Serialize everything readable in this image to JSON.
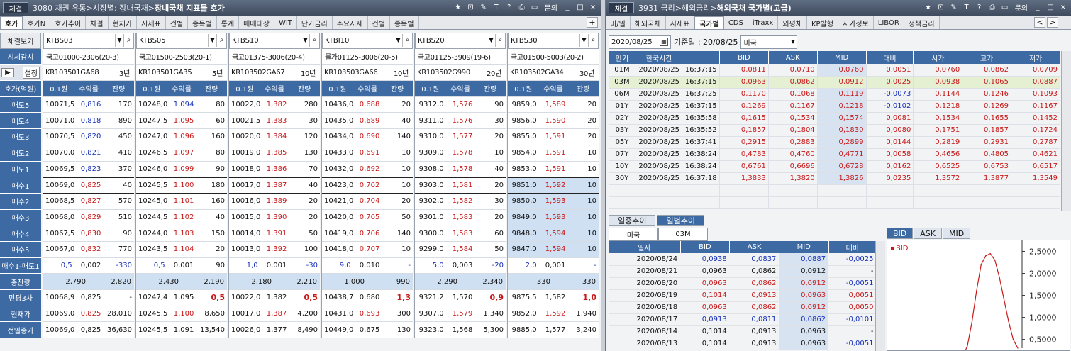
{
  "left": {
    "title_prefix": "3080 채권 유통>시장별: 장내국채>",
    "title_bold": "장내국채 지표물 호가",
    "logo": "체결",
    "tabs": [
      "호가",
      "호가N",
      "호가추이",
      "체결",
      "현재가",
      "시세표",
      "건별",
      "종목별",
      "통계",
      "매매대상",
      "WIT",
      "단기금리",
      "주요시세",
      "건별",
      "종목별"
    ],
    "window_buttons": [
      "★",
      "⊡",
      "✎",
      "T",
      "?",
      "⎙",
      "▭",
      "문의",
      "_",
      "□",
      "×"
    ],
    "add_tab": "+",
    "side_labels": [
      "체결보기",
      "시세감시",
      "설정",
      "호가(억원)",
      "매도5",
      "매도4",
      "매도3",
      "매도2",
      "매도1",
      "매수1",
      "매수2",
      "매수3",
      "매수4",
      "매수5",
      "매수1-매도1",
      "총잔량",
      "민평3사",
      "현재가",
      "전일종가"
    ],
    "side_play": "▶",
    "col_headers": [
      "0.1원",
      "수익률",
      "잔량"
    ],
    "panels": [
      {
        "code": "KTBS03",
        "name": "국고01000-2306(20-3)",
        "isin": "KR103501GA68",
        "term": "3년",
        "rows": [
          [
            "10071,5",
            "0,816",
            "170"
          ],
          [
            "10071,0",
            "0,818",
            "890"
          ],
          [
            "10070,5",
            "0,820",
            "450"
          ],
          [
            "10070,0",
            "0,821",
            "410"
          ],
          [
            "10069,5",
            "0,823",
            "370"
          ],
          [
            "10069,0",
            "0,825",
            "40"
          ],
          [
            "10068,5",
            "0,827",
            "570"
          ],
          [
            "10068,0",
            "0,829",
            "510"
          ],
          [
            "10067,5",
            "0,830",
            "90"
          ],
          [
            "10067,0",
            "0,832",
            "770"
          ]
        ],
        "diff": [
          "0,5",
          "0,002",
          "-330"
        ],
        "total": [
          "2,790",
          "2,820"
        ],
        "minpyeong": [
          "10068,9",
          "0,825",
          "-"
        ],
        "current": [
          "10069,0",
          "0,825",
          "28,010"
        ],
        "prev": [
          "10069,0",
          "0,825",
          "36,630"
        ]
      },
      {
        "code": "KTBS05",
        "name": "국고01500-2503(20-1)",
        "isin": "KR103501GA35",
        "term": "5년",
        "rows": [
          [
            "10248,0",
            "1,094",
            "80"
          ],
          [
            "10247,5",
            "1,095",
            "60"
          ],
          [
            "10247,0",
            "1,096",
            "160"
          ],
          [
            "10246,5",
            "1,097",
            "80"
          ],
          [
            "10246,0",
            "1,099",
            "90"
          ],
          [
            "10245,5",
            "1,100",
            "180"
          ],
          [
            "10245,0",
            "1,101",
            "160"
          ],
          [
            "10244,5",
            "1,102",
            "40"
          ],
          [
            "10244,0",
            "1,103",
            "150"
          ],
          [
            "10243,5",
            "1,104",
            "20"
          ]
        ],
        "diff": [
          "0,5",
          "0,001",
          "90"
        ],
        "total": [
          "2,430",
          "2,190"
        ],
        "minpyeong": [
          "10247,4",
          "1,095",
          "0,5"
        ],
        "current": [
          "10245,5",
          "1,100",
          "8,650"
        ],
        "prev": [
          "10245,5",
          "1,091",
          "13,540"
        ]
      },
      {
        "code": "KTBS10",
        "name": "국고01375-3006(20-4)",
        "isin": "KR103502GA67",
        "term": "10년",
        "rows": [
          [
            "10022,0",
            "1,382",
            "280"
          ],
          [
            "10021,5",
            "1,383",
            "30"
          ],
          [
            "10020,0",
            "1,384",
            "120"
          ],
          [
            "10019,0",
            "1,385",
            "130"
          ],
          [
            "10018,0",
            "1,386",
            "70"
          ],
          [
            "10017,0",
            "1,387",
            "40"
          ],
          [
            "10016,0",
            "1,389",
            "20"
          ],
          [
            "10015,0",
            "1,390",
            "20"
          ],
          [
            "10014,0",
            "1,391",
            "50"
          ],
          [
            "10013,0",
            "1,392",
            "100"
          ]
        ],
        "diff": [
          "1,0",
          "0,001",
          "-30"
        ],
        "total": [
          "2,180",
          "2,210"
        ],
        "minpyeong": [
          "10022,0",
          "1,382",
          "0,5"
        ],
        "current": [
          "10017,0",
          "1,387",
          "4,200"
        ],
        "prev": [
          "10026,0",
          "1,377",
          "8,490"
        ]
      },
      {
        "code": "KTBI10",
        "name": "물가01125-3006(20-5)",
        "isin": "KR103503GA66",
        "term": "10년",
        "rows": [
          [
            "10436,0",
            "0,688",
            "20"
          ],
          [
            "10435,0",
            "0,689",
            "40"
          ],
          [
            "10434,0",
            "0,690",
            "140"
          ],
          [
            "10433,0",
            "0,691",
            "10"
          ],
          [
            "10432,0",
            "0,692",
            "10"
          ],
          [
            "10423,0",
            "0,702",
            "10"
          ],
          [
            "10421,0",
            "0,704",
            "20"
          ],
          [
            "10420,0",
            "0,705",
            "50"
          ],
          [
            "10419,0",
            "0,706",
            "140"
          ],
          [
            "10418,0",
            "0,707",
            "10"
          ]
        ],
        "diff": [
          "9,0",
          "0,010",
          "-"
        ],
        "total": [
          "1,000",
          "990"
        ],
        "minpyeong": [
          "10438,7",
          "0,680",
          "1,3"
        ],
        "current": [
          "10431,0",
          "0,693",
          "300"
        ],
        "prev": [
          "10449,0",
          "0,675",
          "130"
        ]
      },
      {
        "code": "KTBS20",
        "name": "국고01125-3909(19-6)",
        "isin": "KR103502G990",
        "term": "20년",
        "rows": [
          [
            "9312,0",
            "1,576",
            "90"
          ],
          [
            "9311,0",
            "1,576",
            "30"
          ],
          [
            "9310,0",
            "1,577",
            "20"
          ],
          [
            "9309,0",
            "1,578",
            "10"
          ],
          [
            "9308,0",
            "1,578",
            "40"
          ],
          [
            "9303,0",
            "1,581",
            "20"
          ],
          [
            "9302,0",
            "1,582",
            "30"
          ],
          [
            "9301,0",
            "1,583",
            "20"
          ],
          [
            "9300,0",
            "1,583",
            "60"
          ],
          [
            "9299,0",
            "1,584",
            "50"
          ]
        ],
        "diff": [
          "5,0",
          "0,003",
          "-20"
        ],
        "total": [
          "2,290",
          "2,340"
        ],
        "minpyeong": [
          "9321,2",
          "1,570",
          "0,9"
        ],
        "current": [
          "9307,0",
          "1,579",
          "1,340"
        ],
        "prev": [
          "9323,0",
          "1,568",
          "5,300"
        ]
      },
      {
        "code": "KTBS30",
        "name": "국고01500-5003(20-2)",
        "isin": "KR103502GA34",
        "term": "30년",
        "rows": [
          [
            "9859,0",
            "1,589",
            "20"
          ],
          [
            "9856,0",
            "1,590",
            "20"
          ],
          [
            "9855,0",
            "1,591",
            "20"
          ],
          [
            "9854,0",
            "1,591",
            "10"
          ],
          [
            "9853,0",
            "1,591",
            "10"
          ],
          [
            "9851,0",
            "1,592",
            "10"
          ],
          [
            "9850,0",
            "1,593",
            "10"
          ],
          [
            "9849,0",
            "1,593",
            "10"
          ],
          [
            "9848,0",
            "1,594",
            "10"
          ],
          [
            "9847,0",
            "1,594",
            "10"
          ]
        ],
        "diff": [
          "2,0",
          "0,001",
          "-"
        ],
        "total": [
          "330",
          "330"
        ],
        "minpyeong": [
          "9875,5",
          "1,582",
          "1,0"
        ],
        "current": [
          "9852,0",
          "1,592",
          "1,940"
        ],
        "prev": [
          "9885,0",
          "1,577",
          "3,240"
        ]
      }
    ]
  },
  "right": {
    "title_prefix": "3931 금리>해외금리>",
    "title_bold": "해외국채 국가별(고급)",
    "logo": "체결",
    "tabs": [
      "미/일",
      "해외국채",
      "시세표",
      "국가별",
      "CDS",
      "iTraxx",
      "외평채",
      "KP발행",
      "시가정보",
      "LIBOR",
      "정책금리"
    ],
    "window_buttons": [
      "★",
      "⊡",
      "✎",
      "T",
      "?",
      "⎙",
      "▭",
      "문의",
      "_",
      "□",
      "×"
    ],
    "nav": [
      "<",
      ">"
    ],
    "date": "2020/08/25",
    "base_date_label": "기준일 : 20/08/25",
    "country": "미국",
    "headers": [
      "만기",
      "한국시간",
      "",
      "BID",
      "ASK",
      "MID",
      "대비",
      "시가",
      "고가",
      "저가"
    ],
    "rows": [
      [
        "01M",
        "2020/08/25",
        "16:37:15",
        "0,0811",
        "0,0710",
        "0,0760",
        "0,0051",
        "0,0760",
        "0,0862",
        "0,0709"
      ],
      [
        "03M",
        "2020/08/25",
        "16:37:15",
        "0,0963",
        "0,0862",
        "0,0912",
        "0,0025",
        "0,0938",
        "0,1065",
        "0,0887"
      ],
      [
        "06M",
        "2020/08/25",
        "16:37:25",
        "0,1170",
        "0,1068",
        "0,1119",
        "-0,0073",
        "0,1144",
        "0,1246",
        "0,1093"
      ],
      [
        "01Y",
        "2020/08/25",
        "16:37:15",
        "0,1269",
        "0,1167",
        "0,1218",
        "-0,0102",
        "0,1218",
        "0,1269",
        "0,1167"
      ],
      [
        "02Y",
        "2020/08/25",
        "16:35:58",
        "0,1615",
        "0,1534",
        "0,1574",
        "0,0081",
        "0,1534",
        "0,1655",
        "0,1452"
      ],
      [
        "03Y",
        "2020/08/25",
        "16:35:52",
        "0,1857",
        "0,1804",
        "0,1830",
        "0,0080",
        "0,1751",
        "0,1857",
        "0,1724"
      ],
      [
        "05Y",
        "2020/08/25",
        "16:37:41",
        "0,2915",
        "0,2883",
        "0,2899",
        "0,0144",
        "0,2819",
        "0,2931",
        "0,2787"
      ],
      [
        "07Y",
        "2020/08/25",
        "16:38:24",
        "0,4783",
        "0,4760",
        "0,4771",
        "0,0058",
        "0,4656",
        "0,4805",
        "0,4621"
      ],
      [
        "10Y",
        "2020/08/25",
        "16:38:24",
        "0,6761",
        "0,6696",
        "0,6728",
        "0,0162",
        "0,6525",
        "0,6753",
        "0,6517"
      ],
      [
        "30Y",
        "2020/08/25",
        "16:37:18",
        "1,3833",
        "1,3820",
        "1,3826",
        "0,0235",
        "1,3572",
        "1,3877",
        "1,3549"
      ]
    ],
    "subtabs": [
      "일중추이",
      "일별추이"
    ],
    "sub_country": "미국",
    "sub_term": "03M",
    "dheaders": [
      "일자",
      "BID",
      "ASK",
      "MID",
      "대비"
    ],
    "drows": [
      [
        "2020/08/24",
        "0,0938",
        "0,0837",
        "0,0887",
        "-0,0025"
      ],
      [
        "2020/08/21",
        "0,0963",
        "0,0862",
        "0,0912",
        "-"
      ],
      [
        "2020/08/20",
        "0,0963",
        "0,0862",
        "0,0912",
        "-0,0051"
      ],
      [
        "2020/08/19",
        "0,1014",
        "0,0913",
        "0,0963",
        "0,0051"
      ],
      [
        "2020/08/18",
        "0,0963",
        "0,0862",
        "0,0912",
        "0,0050"
      ],
      [
        "2020/08/17",
        "0,0913",
        "0,0811",
        "0,0862",
        "-0,0101"
      ],
      [
        "2020/08/14",
        "0,1014",
        "0,0913",
        "0,0963",
        "-"
      ],
      [
        "2020/08/13",
        "0,1014",
        "0,0913",
        "0,0963",
        "-0,0051"
      ]
    ],
    "chart_tabs": [
      "BID",
      "ASK",
      "MID"
    ],
    "chart_data": {
      "type": "line",
      "series": [
        {
          "name": "BID",
          "values": [
            0.08,
            0.12,
            0.35,
            0.9,
            1.6,
            2.2,
            2.4,
            2.45,
            2.3,
            1.9,
            1.4,
            0.9,
            0.5,
            0.3
          ]
        }
      ],
      "yticks": [
        "2,5000",
        "2,0000",
        "1,5000",
        "1,0000",
        "0,5000"
      ],
      "ylim": [
        0.3,
        2.75
      ]
    }
  }
}
